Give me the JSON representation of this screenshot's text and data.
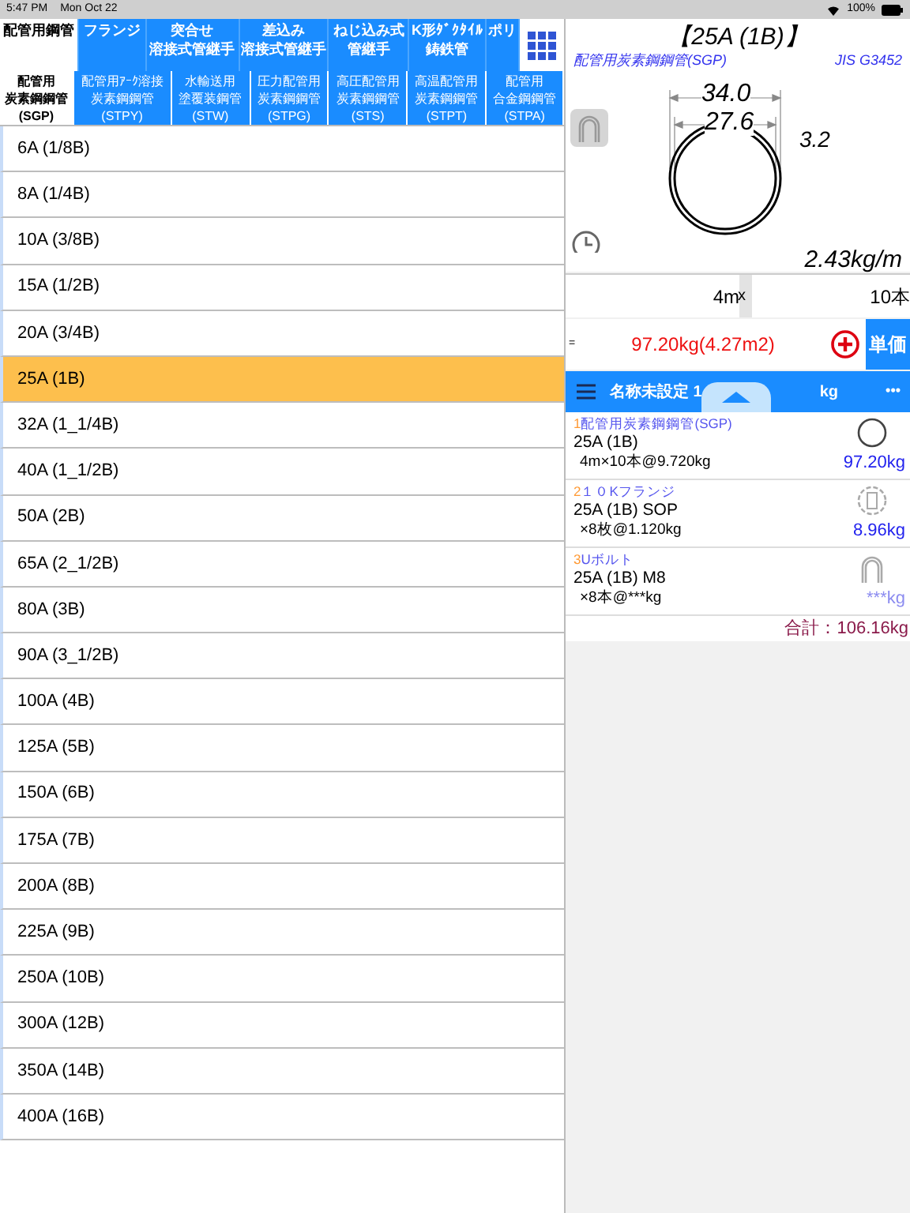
{
  "status_bar": {
    "time": "5:47 PM",
    "date": "Mon Oct 22",
    "battery": "100%"
  },
  "categories": [
    {
      "lines": [
        "配管用鋼管"
      ],
      "selected": true
    },
    {
      "lines": [
        "フランジ"
      ],
      "selected": false
    },
    {
      "lines": [
        "突合せ",
        "溶接式管継手"
      ],
      "selected": false
    },
    {
      "lines": [
        "差込み",
        "溶接式管継手"
      ],
      "selected": false
    },
    {
      "lines": [
        "ねじ込み式",
        "管継手"
      ],
      "selected": false
    },
    {
      "lines": [
        "K形ﾀﾞｸﾀｲﾙ",
        "鋳鉄管"
      ],
      "selected": false
    },
    {
      "lines": [
        "ポリ"
      ],
      "selected": false
    }
  ],
  "subcategories": [
    {
      "lines": [
        "配管用",
        "炭素鋼鋼管",
        "(SGP)"
      ],
      "selected": true
    },
    {
      "lines": [
        "配管用ｱｰｸ溶接",
        "炭素鋼鋼管",
        "(STPY)"
      ],
      "selected": false
    },
    {
      "lines": [
        "水輸送用",
        "塗覆装鋼管",
        "(STW)"
      ],
      "selected": false
    },
    {
      "lines": [
        "圧力配管用",
        "炭素鋼鋼管",
        "(STPG)"
      ],
      "selected": false
    },
    {
      "lines": [
        "高圧配管用",
        "炭素鋼鋼管",
        "(STS)"
      ],
      "selected": false
    },
    {
      "lines": [
        "高温配管用",
        "炭素鋼鋼管",
        "(STPT)"
      ],
      "selected": false
    },
    {
      "lines": [
        "配管用",
        "合金鋼鋼管",
        "(STPA)"
      ],
      "selected": false
    }
  ],
  "sizes": [
    {
      "label": "6A (1/8B)",
      "selected": false
    },
    {
      "label": "8A (1/4B)",
      "selected": false
    },
    {
      "label": "10A (3/8B)",
      "selected": false
    },
    {
      "label": "15A (1/2B)",
      "selected": false
    },
    {
      "label": "20A (3/4B)",
      "selected": false
    },
    {
      "label": "25A (1B)",
      "selected": true
    },
    {
      "label": "32A (1_1/4B)",
      "selected": false
    },
    {
      "label": "40A (1_1/2B)",
      "selected": false
    },
    {
      "label": "50A (2B)",
      "selected": false
    },
    {
      "label": "65A (2_1/2B)",
      "selected": false
    },
    {
      "label": "80A (3B)",
      "selected": false
    },
    {
      "label": "90A (3_1/2B)",
      "selected": false
    },
    {
      "label": "100A (4B)",
      "selected": false
    },
    {
      "label": "125A (5B)",
      "selected": false
    },
    {
      "label": "150A (6B)",
      "selected": false
    },
    {
      "label": "175A (7B)",
      "selected": false
    },
    {
      "label": "200A (8B)",
      "selected": false
    },
    {
      "label": "225A (9B)",
      "selected": false
    },
    {
      "label": "250A (10B)",
      "selected": false
    },
    {
      "label": "300A (12B)",
      "selected": false
    },
    {
      "label": "350A (14B)",
      "selected": false
    },
    {
      "label": "400A (16B)",
      "selected": false
    }
  ],
  "detail": {
    "title": "【25A (1B)】",
    "material": "配管用炭素鋼鋼管(SGP)",
    "standard": "JIS G3452",
    "outer_diameter": "34.0",
    "inner_diameter": "27.6",
    "thickness": "3.2",
    "unit_weight": "2.43kg/m"
  },
  "inputs": {
    "length": "4m",
    "multiplier": "x",
    "count": "10本"
  },
  "result": {
    "prefix": "=",
    "value": "97.20kg(4.27m2)",
    "unit_price_button": "単価"
  },
  "list_bar": {
    "name": "名称未設定 1",
    "unit": "kg",
    "more": "•••"
  },
  "items": [
    {
      "number": "1",
      "kind": "pipe",
      "category": "配管用炭素鋼鋼管(SGP)",
      "size": "25A (1B)",
      "detail": "4m×10本@9.720kg",
      "weight": "97.20kg",
      "disabled": false
    },
    {
      "number": "2",
      "kind": "flange",
      "category": "１０Kフランジ",
      "size": "25A (1B) SOP",
      "detail": "×8枚@1.120kg",
      "weight": "8.96kg",
      "disabled": false
    },
    {
      "number": "3",
      "kind": "ubolt",
      "category": "Uボルト",
      "size": "25A (1B) M8",
      "detail": "×8本@***kg",
      "weight": "***kg",
      "disabled": true
    }
  ],
  "total": "合計：106.16kg"
}
